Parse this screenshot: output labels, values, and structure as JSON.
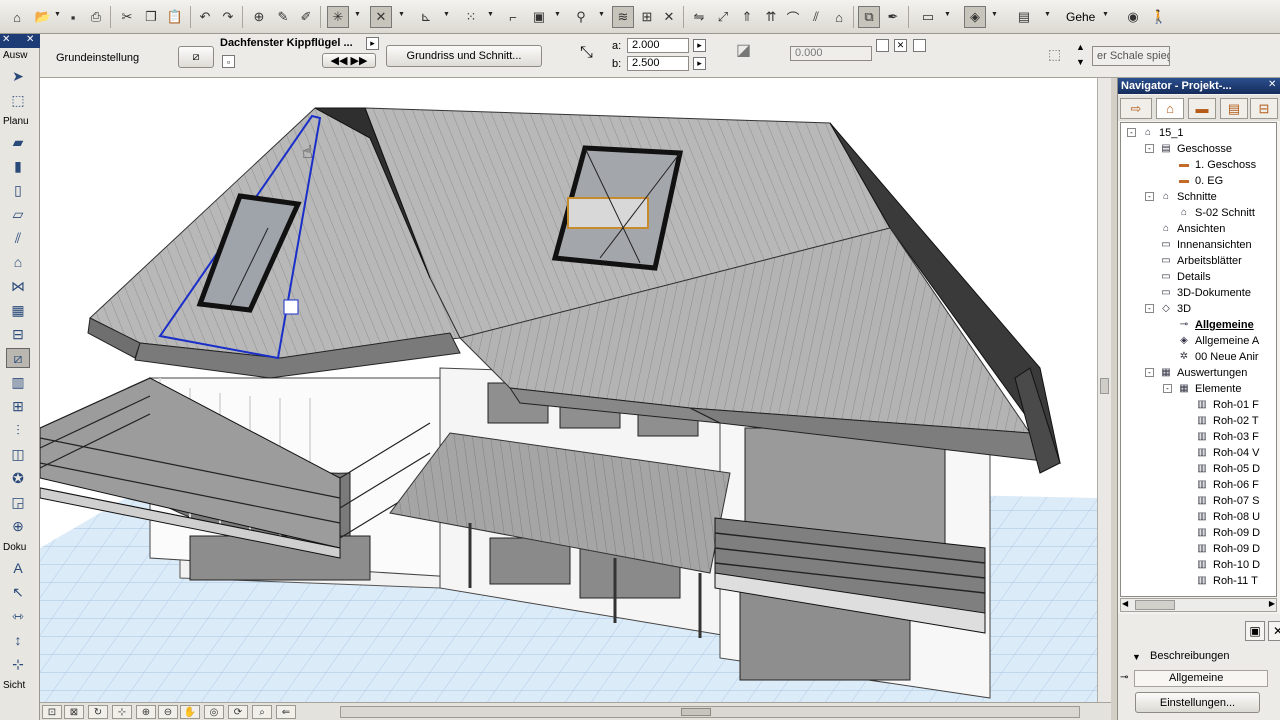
{
  "toolbar": {
    "goto_label": "Gehe"
  },
  "toolbox": {
    "sections": {
      "auswahl": "Ausw",
      "planung": "Planu",
      "doku": "Doku",
      "sicht": "Sicht"
    }
  },
  "infobox": {
    "preset_label": "Grundeinstellung",
    "object_name": "Dachfenster Kippflügel ...",
    "view_button": "Grundriss und Schnitt...",
    "a_label": "a:",
    "a_value": "2.000",
    "b_label": "b:",
    "b_value": "2.500",
    "angle_value": "0.000",
    "mirror_label": "er Schale spieg"
  },
  "navigator": {
    "title": "Navigator - Projekt-...",
    "tree": [
      {
        "label": "15_1",
        "level": 0,
        "icon": "house-icon",
        "expander": "-"
      },
      {
        "label": "Geschosse",
        "level": 1,
        "icon": "stories-icon",
        "expander": "-"
      },
      {
        "label": "1. Geschoss",
        "level": 2,
        "icon": "story-icon",
        "expander": ""
      },
      {
        "label": "0. EG",
        "level": 2,
        "icon": "story-icon",
        "expander": ""
      },
      {
        "label": "Schnitte",
        "level": 1,
        "icon": "section-icon",
        "expander": "-"
      },
      {
        "label": "S-02 Schnitt",
        "level": 2,
        "icon": "section-view-icon",
        "expander": ""
      },
      {
        "label": "Ansichten",
        "level": 1,
        "icon": "elevation-icon",
        "expander": ""
      },
      {
        "label": "Innenansichten",
        "level": 1,
        "icon": "interior-elevation-icon",
        "expander": ""
      },
      {
        "label": "Arbeitsblätter",
        "level": 1,
        "icon": "worksheet-icon",
        "expander": ""
      },
      {
        "label": "Details",
        "level": 1,
        "icon": "detail-icon",
        "expander": ""
      },
      {
        "label": "3D-Dokumente",
        "level": 1,
        "icon": "3d-document-icon",
        "expander": ""
      },
      {
        "label": "3D",
        "level": 1,
        "icon": "3d-icon",
        "expander": "-"
      },
      {
        "label": "Allgemeine",
        "level": 2,
        "icon": "camera-icon",
        "expander": "",
        "bold": true
      },
      {
        "label": "Allgemeine A",
        "level": 2,
        "icon": "axon-icon",
        "expander": ""
      },
      {
        "label": "00 Neue Anir",
        "level": 2,
        "icon": "animation-icon",
        "expander": ""
      },
      {
        "label": "Auswertungen",
        "level": 1,
        "icon": "schedule-icon",
        "expander": "-"
      },
      {
        "label": "Elemente",
        "level": 2,
        "icon": "element-list-icon",
        "expander": "-"
      },
      {
        "label": "Roh-01 F",
        "level": 3,
        "icon": "schedule-item-icon",
        "expander": ""
      },
      {
        "label": "Roh-02 T",
        "level": 3,
        "icon": "schedule-item-icon",
        "expander": ""
      },
      {
        "label": "Roh-03 F",
        "level": 3,
        "icon": "schedule-item-icon",
        "expander": ""
      },
      {
        "label": "Roh-04 V",
        "level": 3,
        "icon": "schedule-item-icon",
        "expander": ""
      },
      {
        "label": "Roh-05 D",
        "level": 3,
        "icon": "schedule-item-icon",
        "expander": ""
      },
      {
        "label": "Roh-06 F",
        "level": 3,
        "icon": "schedule-item-icon",
        "expander": ""
      },
      {
        "label": "Roh-07 S",
        "level": 3,
        "icon": "schedule-item-icon",
        "expander": ""
      },
      {
        "label": "Roh-08 U",
        "level": 3,
        "icon": "schedule-item-icon",
        "expander": ""
      },
      {
        "label": "Roh-09 D",
        "level": 3,
        "icon": "schedule-item-icon",
        "expander": ""
      },
      {
        "label": "Roh-09 D",
        "level": 3,
        "icon": "schedule-item-icon",
        "expander": ""
      },
      {
        "label": "Roh-10 D",
        "level": 3,
        "icon": "schedule-item-icon",
        "expander": ""
      },
      {
        "label": "Roh-11 T",
        "level": 3,
        "icon": "schedule-item-icon",
        "expander": ""
      }
    ],
    "descriptions_label": "Beschreibungen",
    "general_label": "Allgemeine",
    "settings_button": "Einstellungen..."
  },
  "colors": {
    "title_bar": "#1d3b75",
    "selection_outline": "#1a2fc9",
    "ground_grid": "#bcd7ef",
    "roof": "#a9a9a9"
  }
}
